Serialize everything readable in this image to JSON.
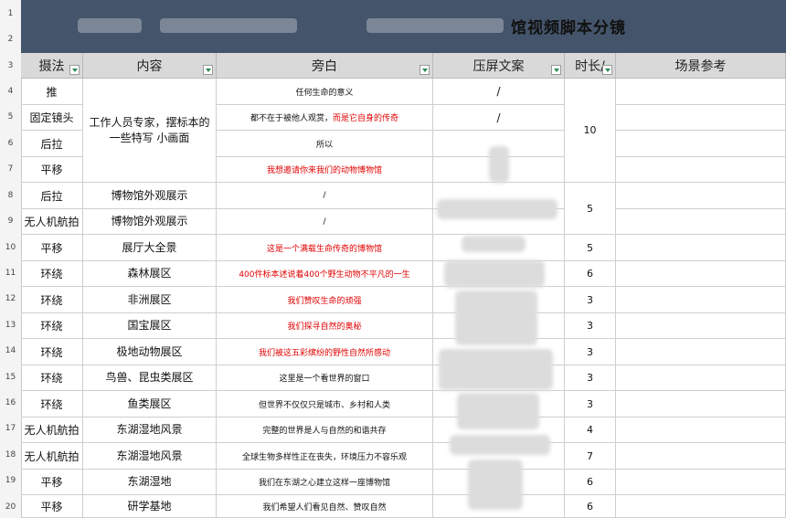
{
  "row_numbers": [
    "1",
    "2",
    "3",
    "4",
    "5",
    "6",
    "7",
    "8",
    "9",
    "10",
    "11",
    "12",
    "13",
    "14",
    "15",
    "16",
    "17",
    "18",
    "19",
    "20"
  ],
  "title": "馆视频脚本分镜",
  "headers": {
    "technique": "摄法",
    "content": "内容",
    "narration": "旁白",
    "caption": "压屏文案",
    "duration": "时长/",
    "reference": "场景参考"
  },
  "rows": [
    {
      "technique": "推",
      "content": "",
      "narration": "任何生命的意义",
      "narration_red": "",
      "caption": "/",
      "duration": ""
    },
    {
      "technique": "固定镜头",
      "content": "",
      "narration": "都不在于被他人观赏，",
      "narration_red": "而是它自身的传奇",
      "caption": "/",
      "duration": ""
    },
    {
      "technique": "后拉",
      "content": "",
      "narration": "所以",
      "narration_red": "",
      "caption": "",
      "duration": ""
    },
    {
      "technique": "平移",
      "content": "",
      "narration": "",
      "narration_red": "我想邀请你来我们的动物博物馆",
      "caption": "",
      "duration": ""
    },
    {
      "technique": "后拉",
      "content": "博物馆外观展示",
      "narration": "/",
      "narration_red": "",
      "caption": "",
      "duration": ""
    },
    {
      "technique": "无人机航拍",
      "content": "博物馆外观展示",
      "narration": "/",
      "narration_red": "",
      "caption": "",
      "duration": ""
    },
    {
      "technique": "平移",
      "content": "展厅大全景",
      "narration": "",
      "narration_red": "这是一个满载生命传奇的博物馆",
      "caption": "",
      "duration": "5"
    },
    {
      "technique": "环绕",
      "content": "森林展区",
      "narration": "",
      "narration_red": "400件标本述说着400个野生动物不平凡的一生",
      "caption": "",
      "duration": "6"
    },
    {
      "technique": "环绕",
      "content": "非洲展区",
      "narration": "",
      "narration_red": "我们赞叹生命的顽强",
      "caption": "",
      "duration": "3"
    },
    {
      "technique": "环绕",
      "content": "国宝展区",
      "narration": "",
      "narration_red": "我们探寻自然的奥秘",
      "caption": "",
      "duration": "3"
    },
    {
      "technique": "环绕",
      "content": "极地动物展区",
      "narration": "",
      "narration_red": "我们被这五彩缤纷的野性自然所感动",
      "caption": "",
      "duration": "3"
    },
    {
      "technique": "环绕",
      "content": "鸟兽、昆虫类展区",
      "narration": "这里是一个看世界的窗口",
      "narration_red": "",
      "caption": "",
      "duration": "3"
    },
    {
      "technique": "环绕",
      "content": "鱼类展区",
      "narration": "但世界不仅仅只是城市、乡村和人类",
      "narration_red": "",
      "caption": "",
      "duration": "3"
    },
    {
      "technique": "无人机航拍",
      "content": "东湖湿地风景",
      "narration": "完整的世界是人与自然的和谐共存",
      "narration_red": "",
      "caption": "",
      "duration": "4"
    },
    {
      "technique": "无人机航拍",
      "content": "东湖湿地风景",
      "narration": "全球生物多样性正在丧失，环境压力不容乐观",
      "narration_red": "",
      "caption": "",
      "duration": "7"
    },
    {
      "technique": "平移",
      "content": "东湖湿地",
      "narration": "我们在东湖之心建立这样一座博物馆",
      "narration_red": "",
      "caption": "",
      "duration": "6"
    },
    {
      "technique": "平移",
      "content": "研学基地",
      "narration": "我们希望人们看见自然、赞叹自然",
      "narration_red": "",
      "caption": "",
      "duration": "6"
    }
  ],
  "merged": {
    "content_rows_4_7": "工作人员专家，摆标本的一些特写 小画面",
    "duration_rows_4_7": "10",
    "duration_rows_8_9": "5"
  }
}
